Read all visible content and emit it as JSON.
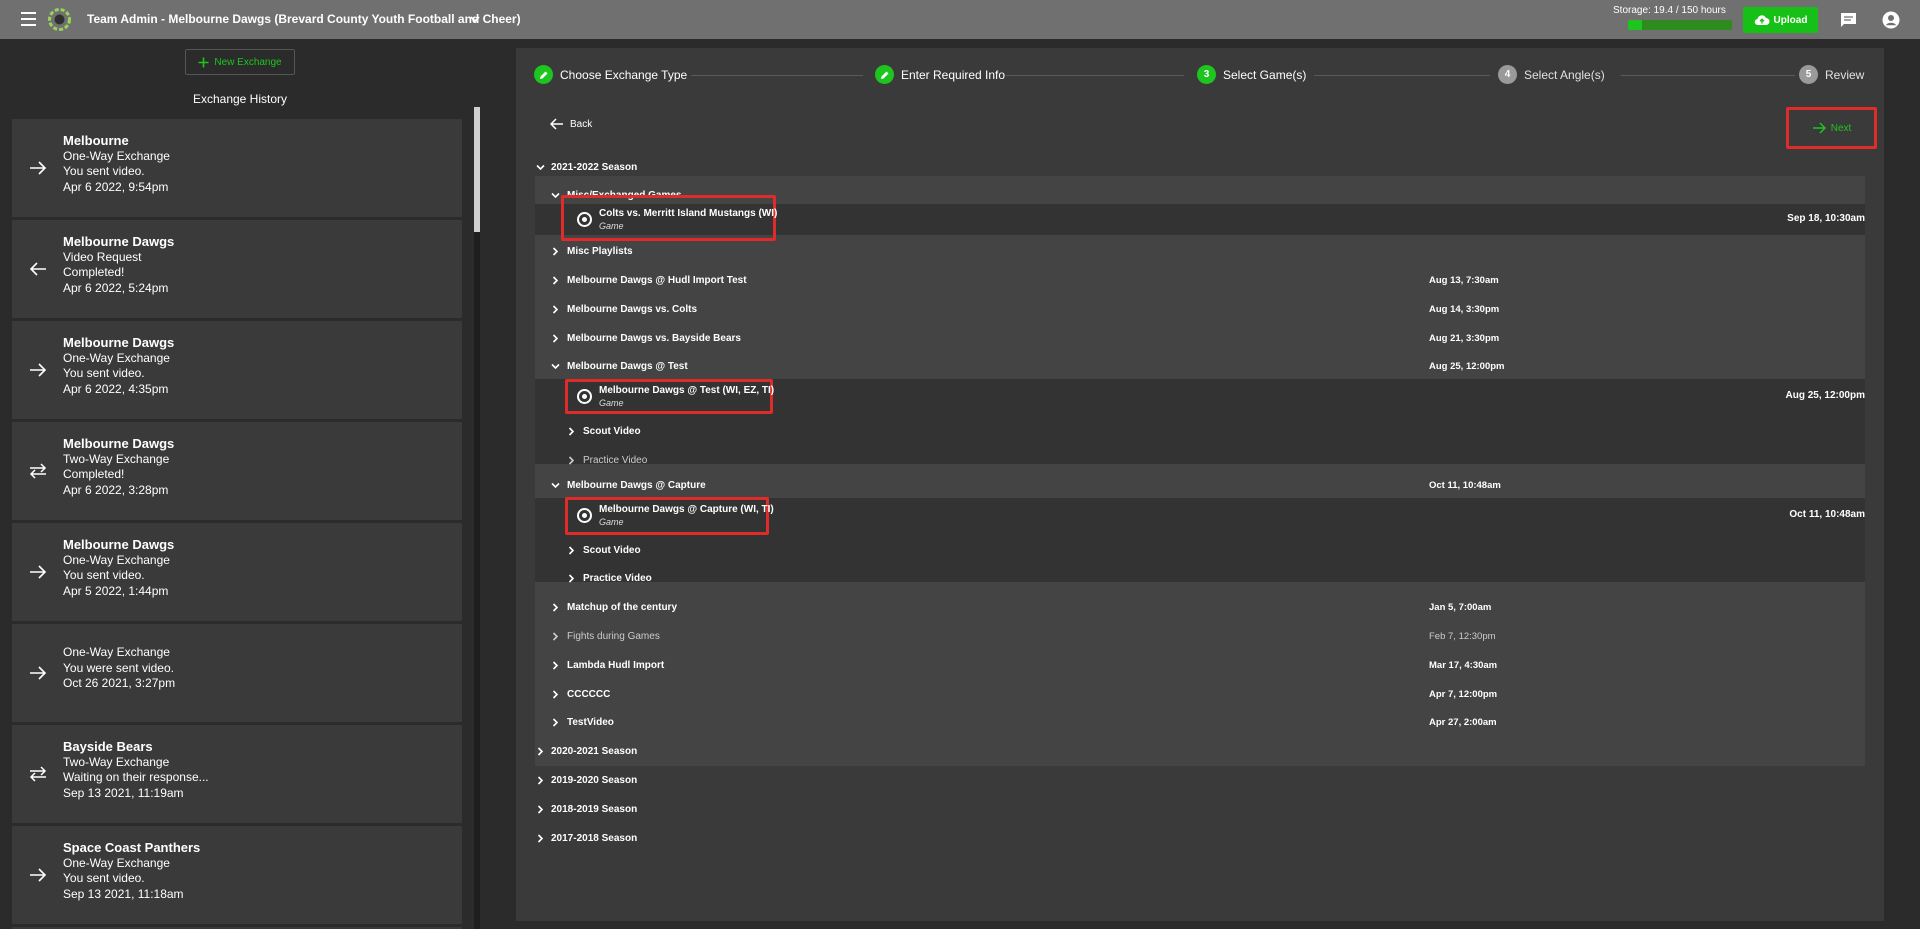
{
  "topbar": {
    "title": "Team Admin - Melbourne Dawgs (Brevard County Youth Football and Cheer)",
    "storage_label": "Storage: 19.4 / 150 hours",
    "storage_fraction": 0.13,
    "upload_label": "Upload",
    "accent": "#1ec51e"
  },
  "left": {
    "new_exchange_label": "New Exchange",
    "history_title": "Exchange History",
    "cards": [
      {
        "icon": "arrow-right-icon",
        "name": "Melbourne",
        "type": "One-Way Exchange",
        "status": "You sent video.",
        "date": "Apr 6 2022, 9:54pm"
      },
      {
        "icon": "arrow-left-icon",
        "name": "Melbourne Dawgs",
        "type": "Video Request",
        "status": "Completed!",
        "date": "Apr 6 2022, 5:24pm"
      },
      {
        "icon": "arrow-right-icon",
        "name": "Melbourne Dawgs",
        "type": "One-Way Exchange",
        "status": "You sent video.",
        "date": "Apr 6 2022, 4:35pm"
      },
      {
        "icon": "swap-icon",
        "name": "Melbourne Dawgs",
        "type": "Two-Way Exchange",
        "status": "Completed!",
        "date": "Apr 6 2022, 3:28pm"
      },
      {
        "icon": "arrow-right-icon",
        "name": "Melbourne Dawgs",
        "type": "One-Way Exchange",
        "status": "You sent video.",
        "date": "Apr 5 2022, 1:44pm"
      },
      {
        "icon": "arrow-right-icon",
        "name": "",
        "type": "One-Way Exchange",
        "status": "You were sent video.",
        "date": "Oct 26 2021, 3:27pm"
      },
      {
        "icon": "swap-icon",
        "name": "Bayside Bears",
        "type": "Two-Way Exchange",
        "status": "Waiting on their response...",
        "date": "Sep 13 2021, 11:19am"
      },
      {
        "icon": "arrow-right-icon",
        "name": "Space Coast Panthers",
        "type": "One-Way Exchange",
        "status": "You sent video.",
        "date": "Sep 13 2021, 11:18am"
      }
    ]
  },
  "stepper": {
    "steps": [
      {
        "num": "",
        "label": "Choose Exchange Type",
        "state": "done"
      },
      {
        "num": "",
        "label": "Enter Required Info",
        "state": "done"
      },
      {
        "num": "3",
        "label": "Select Game(s)",
        "state": "active"
      },
      {
        "num": "4",
        "label": "Select Angle(s)",
        "state": "todo"
      },
      {
        "num": "5",
        "label": "Review",
        "state": "todo"
      }
    ]
  },
  "nav": {
    "back_label": "Back",
    "next_label": "Next"
  },
  "tree": {
    "season_2122": "2021-2022 Season",
    "misc_folder": "Misc/Exchanged Games",
    "game1_title": "Colts vs. Merritt Island Mustangs (WI)",
    "game1_sub": "Game",
    "game1_date": "Sep 18, 10:30am",
    "misc_playlists": "Misc Playlists",
    "hudl_import": "Melbourne Dawgs @ Hudl Import Test",
    "hudl_import_date": "Aug 13, 7:30am",
    "vs_colts": "Melbourne Dawgs vs. Colts",
    "vs_colts_date": "Aug 14, 3:30pm",
    "vs_bayside": "Melbourne Dawgs vs. Bayside Bears",
    "vs_bayside_date": "Aug 21, 3:30pm",
    "at_test": "Melbourne Dawgs @ Test",
    "at_test_date": "Aug 25, 12:00pm",
    "game2_title": "Melbourne Dawgs @ Test (WI, EZ, TI)",
    "game2_sub": "Game",
    "game2_date": "Aug 25, 12:00pm",
    "scout_video_1": "Scout Video",
    "practice_video_1": "Practice Video",
    "at_capture": "Melbourne Dawgs @ Capture",
    "at_capture_date": "Oct 11, 10:48am",
    "game3_title": "Melbourne Dawgs @ Capture (WI, TI)",
    "game3_sub": "Game",
    "game3_date": "Oct 11, 10:48am",
    "scout_video_2": "Scout Video",
    "practice_video_2": "Practice Video",
    "matchup": "Matchup of the century",
    "matchup_date": "Jan 5, 7:00am",
    "fights": "Fights during Games",
    "fights_date": "Feb 7, 12:30pm",
    "lambda": "Lambda Hudl Import",
    "lambda_date": "Mar 17, 4:30am",
    "cccccc": "CCCCCC",
    "cccccc_date": "Apr 7, 12:00pm",
    "testvideo": "TestVideo",
    "testvideo_date": "Apr 27, 2:00am",
    "season_2021": "2020-2021 Season",
    "season_1920": "2019-2020 Season",
    "season_1819": "2018-2019 Season",
    "season_1718": "2017-2018 Season"
  }
}
